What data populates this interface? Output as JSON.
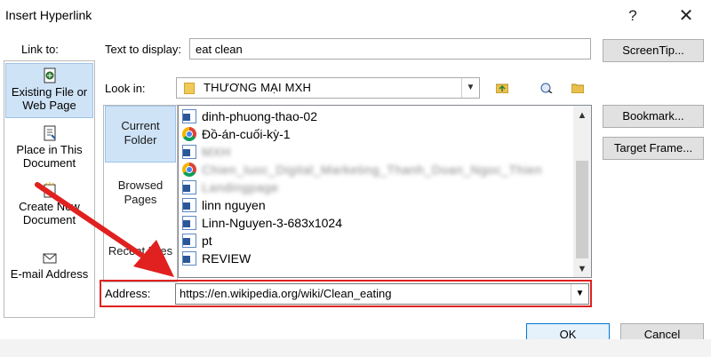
{
  "window": {
    "title": "Insert Hyperlink",
    "help_glyph": "?",
    "close_glyph": "✕"
  },
  "link_to": {
    "label": "Link to:",
    "items": [
      {
        "label_line1": "Existing File or",
        "label_line2": "Web Page",
        "icon": "existing-file-icon",
        "selected": true
      },
      {
        "label_line1": "Place in This",
        "label_line2": "Document",
        "icon": "place-in-document-icon",
        "selected": false
      },
      {
        "label_line1": "Create New",
        "label_line2": "Document",
        "icon": "new-document-icon",
        "selected": false
      },
      {
        "label_line1": "E-mail Address",
        "label_line2": "",
        "icon": "email-icon",
        "selected": false
      }
    ]
  },
  "text_to_display": {
    "label": "Text to display:",
    "value": "eat clean"
  },
  "look_in": {
    "label": "Look in:",
    "value": "THƯƠNG MẠI MXH"
  },
  "places": [
    {
      "line1": "Current",
      "line2": "Folder",
      "selected": true
    },
    {
      "line1": "Browsed",
      "line2": "Pages",
      "selected": false
    },
    {
      "line1": "Recent Files",
      "line2": "",
      "selected": false
    }
  ],
  "files": [
    {
      "name": "dinh-phuong-thao-02",
      "icon": "word-doc-icon",
      "blurred": false
    },
    {
      "name": "Đồ-án-cuối-kỳ-1",
      "icon": "chrome-icon",
      "blurred": false
    },
    {
      "name": "MXH",
      "icon": "word-doc-icon",
      "blurred": true
    },
    {
      "name": "Chien_luoc_Digital_Marketing_Thanh_Doan_Ngoc_Thien",
      "icon": "chrome-icon",
      "blurred": true
    },
    {
      "name": "Landingpage",
      "icon": "word-doc-icon",
      "blurred": true
    },
    {
      "name": "linn nguyen",
      "icon": "word-doc-icon",
      "blurred": false
    },
    {
      "name": "Linn-Nguyen-3-683x1024",
      "icon": "word-doc-icon",
      "blurred": false
    },
    {
      "name": "pt",
      "icon": "word-doc-icon",
      "blurred": false
    },
    {
      "name": "REVIEW",
      "icon": "word-doc-icon",
      "blurred": false
    }
  ],
  "address": {
    "label": "Address:",
    "value": "https://en.wikipedia.org/wiki/Clean_eating"
  },
  "buttons": {
    "screentip": "ScreenTip...",
    "bookmark": "Bookmark...",
    "target_frame": "Target Frame...",
    "ok": "OK",
    "cancel": "Cancel"
  },
  "colors": {
    "highlight_red": "#e0211f",
    "selection_blue": "#cfe3f7"
  }
}
